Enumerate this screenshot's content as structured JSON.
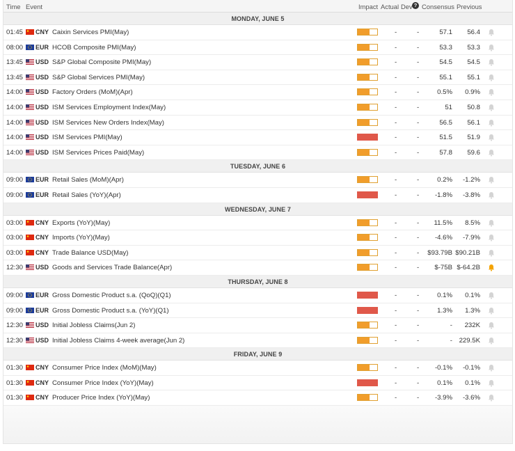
{
  "header": {
    "time": "Time",
    "event": "Event",
    "impact": "Impact",
    "actual": "Actual",
    "dev": "Dev",
    "info": "?",
    "consensus": "Consensus",
    "previous": "Previous"
  },
  "colors": {
    "medium": "#f19d2b",
    "high": "#e0584a",
    "bell_active": "#f4a300",
    "bell_inactive": "#d4d4d4"
  },
  "days": [
    {
      "label": "MONDAY, JUNE 5",
      "events": [
        {
          "time": "01:45",
          "cur": "CNY",
          "flag": "cn-flag-icon",
          "name": "Caixin Services PMI(May)",
          "impact": "medium",
          "actual": "-",
          "dev": "-",
          "cons": "57.1",
          "prev": "56.4",
          "bell": "inactive"
        },
        {
          "time": "08:00",
          "cur": "EUR",
          "flag": "eu-flag-icon",
          "name": "HCOB Composite PMI(May)",
          "impact": "medium",
          "actual": "-",
          "dev": "-",
          "cons": "53.3",
          "prev": "53.3",
          "bell": "inactive"
        },
        {
          "time": "13:45",
          "cur": "USD",
          "flag": "us-flag-icon",
          "name": "S&P Global Composite PMI(May)",
          "impact": "medium",
          "actual": "-",
          "dev": "-",
          "cons": "54.5",
          "prev": "54.5",
          "bell": "inactive"
        },
        {
          "time": "13:45",
          "cur": "USD",
          "flag": "us-flag-icon",
          "name": "S&P Global Services PMI(May)",
          "impact": "medium",
          "actual": "-",
          "dev": "-",
          "cons": "55.1",
          "prev": "55.1",
          "bell": "inactive"
        },
        {
          "time": "14:00",
          "cur": "USD",
          "flag": "us-flag-icon",
          "name": "Factory Orders (MoM)(Apr)",
          "impact": "medium",
          "actual": "-",
          "dev": "-",
          "cons": "0.5%",
          "prev": "0.9%",
          "bell": "inactive"
        },
        {
          "time": "14:00",
          "cur": "USD",
          "flag": "us-flag-icon",
          "name": "ISM Services Employment Index(May)",
          "impact": "medium",
          "actual": "-",
          "dev": "-",
          "cons": "51",
          "prev": "50.8",
          "bell": "inactive"
        },
        {
          "time": "14:00",
          "cur": "USD",
          "flag": "us-flag-icon",
          "name": "ISM Services New Orders Index(May)",
          "impact": "medium",
          "actual": "-",
          "dev": "-",
          "cons": "56.5",
          "prev": "56.1",
          "bell": "inactive"
        },
        {
          "time": "14:00",
          "cur": "USD",
          "flag": "us-flag-icon",
          "name": "ISM Services PMI(May)",
          "impact": "high",
          "actual": "-",
          "dev": "-",
          "cons": "51.5",
          "prev": "51.9",
          "bell": "inactive"
        },
        {
          "time": "14:00",
          "cur": "USD",
          "flag": "us-flag-icon",
          "name": "ISM Services Prices Paid(May)",
          "impact": "medium",
          "actual": "-",
          "dev": "-",
          "cons": "57.8",
          "prev": "59.6",
          "bell": "inactive"
        }
      ]
    },
    {
      "label": "TUESDAY, JUNE 6",
      "events": [
        {
          "time": "09:00",
          "cur": "EUR",
          "flag": "eu-flag-icon",
          "name": "Retail Sales (MoM)(Apr)",
          "impact": "medium",
          "actual": "-",
          "dev": "-",
          "cons": "0.2%",
          "prev": "-1.2%",
          "bell": "inactive"
        },
        {
          "time": "09:00",
          "cur": "EUR",
          "flag": "eu-flag-icon",
          "name": "Retail Sales (YoY)(Apr)",
          "impact": "high",
          "actual": "-",
          "dev": "-",
          "cons": "-1.8%",
          "prev": "-3.8%",
          "bell": "inactive"
        }
      ]
    },
    {
      "label": "WEDNESDAY, JUNE 7",
      "events": [
        {
          "time": "03:00",
          "cur": "CNY",
          "flag": "cn-flag-icon",
          "name": "Exports (YoY)(May)",
          "impact": "medium",
          "actual": "-",
          "dev": "-",
          "cons": "11.5%",
          "prev": "8.5%",
          "bell": "inactive"
        },
        {
          "time": "03:00",
          "cur": "CNY",
          "flag": "cn-flag-icon",
          "name": "Imports (YoY)(May)",
          "impact": "medium",
          "actual": "-",
          "dev": "-",
          "cons": "-4.6%",
          "prev": "-7.9%",
          "bell": "inactive"
        },
        {
          "time": "03:00",
          "cur": "CNY",
          "flag": "cn-flag-icon",
          "name": "Trade Balance USD(May)",
          "impact": "medium",
          "actual": "-",
          "dev": "-",
          "cons": "$93.79B",
          "prev": "$90.21B",
          "bell": "inactive"
        },
        {
          "time": "12:30",
          "cur": "USD",
          "flag": "us-flag-icon",
          "name": "Goods and Services Trade Balance(Apr)",
          "impact": "medium",
          "actual": "-",
          "dev": "-",
          "cons": "$-75B",
          "prev": "$-64.2B",
          "bell": "active"
        }
      ]
    },
    {
      "label": "THURSDAY, JUNE 8",
      "events": [
        {
          "time": "09:00",
          "cur": "EUR",
          "flag": "eu-flag-icon",
          "name": "Gross Domestic Product s.a. (QoQ)(Q1)",
          "impact": "high",
          "actual": "-",
          "dev": "-",
          "cons": "0.1%",
          "prev": "0.1%",
          "bell": "inactive"
        },
        {
          "time": "09:00",
          "cur": "EUR",
          "flag": "eu-flag-icon",
          "name": "Gross Domestic Product s.a. (YoY)(Q1)",
          "impact": "high",
          "actual": "-",
          "dev": "-",
          "cons": "1.3%",
          "prev": "1.3%",
          "bell": "inactive"
        },
        {
          "time": "12:30",
          "cur": "USD",
          "flag": "us-flag-icon",
          "name": "Initial Jobless Claims(Jun 2)",
          "impact": "medium",
          "actual": "-",
          "dev": "-",
          "cons": "-",
          "prev": "232K",
          "bell": "inactive"
        },
        {
          "time": "12:30",
          "cur": "USD",
          "flag": "us-flag-icon",
          "name": "Initial Jobless Claims 4-week average(Jun 2)",
          "impact": "medium",
          "actual": "-",
          "dev": "-",
          "cons": "-",
          "prev": "229.5K",
          "bell": "inactive"
        }
      ]
    },
    {
      "label": "FRIDAY, JUNE 9",
      "events": [
        {
          "time": "01:30",
          "cur": "CNY",
          "flag": "cn-flag-icon",
          "name": "Consumer Price Index (MoM)(May)",
          "impact": "medium",
          "actual": "-",
          "dev": "-",
          "cons": "-0.1%",
          "prev": "-0.1%",
          "bell": "inactive"
        },
        {
          "time": "01:30",
          "cur": "CNY",
          "flag": "cn-flag-icon",
          "name": "Consumer Price Index (YoY)(May)",
          "impact": "high",
          "actual": "-",
          "dev": "-",
          "cons": "0.1%",
          "prev": "0.1%",
          "bell": "inactive"
        },
        {
          "time": "01:30",
          "cur": "CNY",
          "flag": "cn-flag-icon",
          "name": "Producer Price Index (YoY)(May)",
          "impact": "medium",
          "actual": "-",
          "dev": "-",
          "cons": "-3.9%",
          "prev": "-3.6%",
          "bell": "inactive"
        }
      ]
    }
  ]
}
